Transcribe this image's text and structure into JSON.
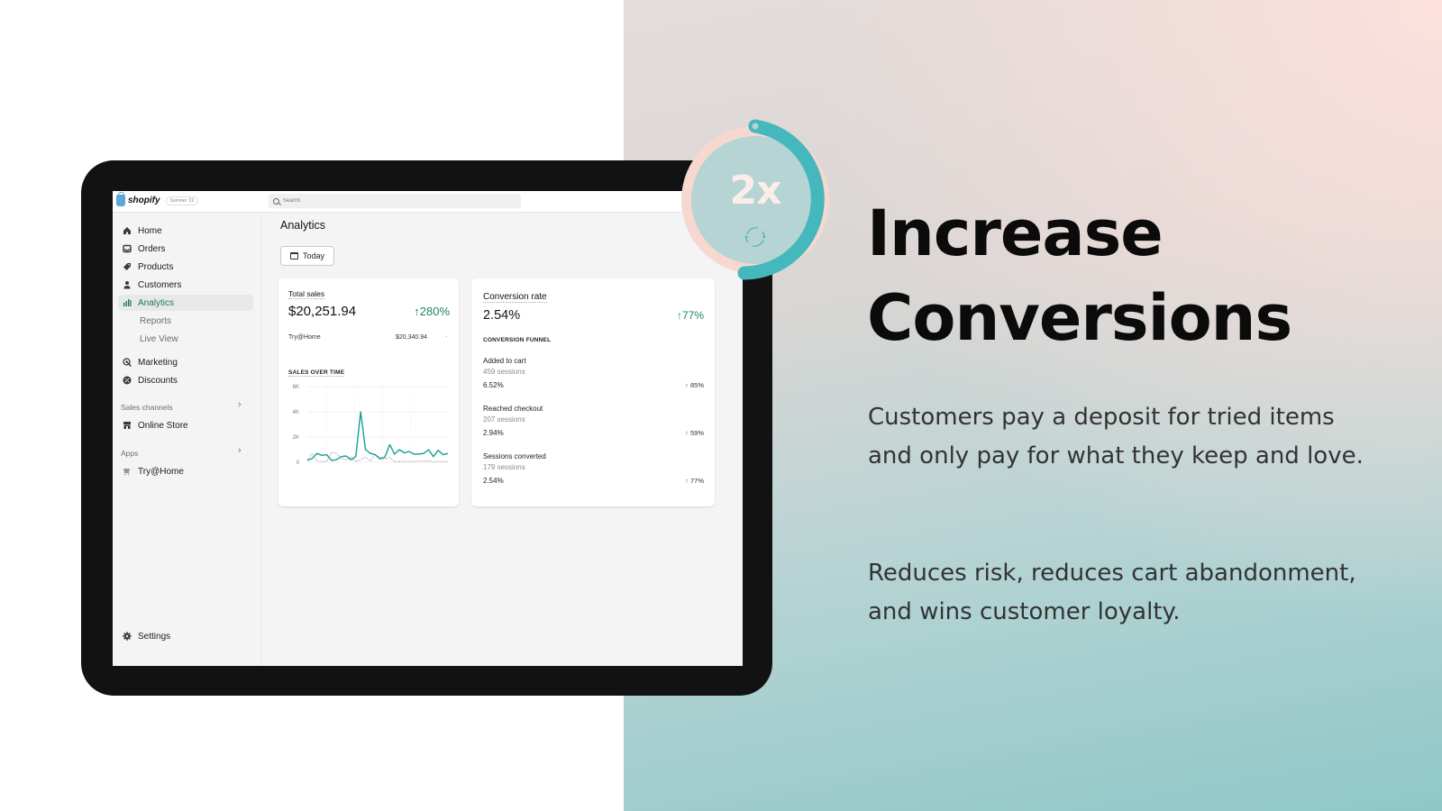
{
  "app": {
    "brand": "shopify",
    "edition_badge": "Summer '22",
    "search": {
      "placeholder": "Search",
      "value": ""
    }
  },
  "sidebar": {
    "items": [
      {
        "label": "Home",
        "icon": "home-icon"
      },
      {
        "label": "Orders",
        "icon": "inbox-icon"
      },
      {
        "label": "Products",
        "icon": "tag-icon"
      },
      {
        "label": "Customers",
        "icon": "person-icon"
      },
      {
        "label": "Analytics",
        "icon": "bar-chart-icon",
        "active": true
      },
      {
        "label": "Reports",
        "sub": true
      },
      {
        "label": "Live View",
        "sub": true
      },
      {
        "label": "Marketing",
        "icon": "target-icon"
      },
      {
        "label": "Discounts",
        "icon": "percent-badge-icon"
      }
    ],
    "sales_channels": {
      "label": "Sales channels",
      "items": [
        {
          "label": "Online Store",
          "icon": "store-icon"
        }
      ]
    },
    "apps": {
      "label": "Apps",
      "items": [
        {
          "label": "Try@Home",
          "icon": "app-icon"
        }
      ]
    },
    "settings": {
      "label": "Settings",
      "icon": "gear-icon"
    }
  },
  "main": {
    "title": "Analytics",
    "date_button": "Today",
    "total_sales": {
      "label": "Total sales",
      "value": "$20,251.94",
      "delta": "280%",
      "breakdown": [
        {
          "name": "Try@Home",
          "value": "$20,340.94",
          "delta": "-"
        }
      ],
      "chart_title": "SALES OVER TIME"
    },
    "conversion": {
      "label": "Conversion rate",
      "value": "2.54%",
      "delta": "77%",
      "funnel_title": "CONVERSION FUNNEL",
      "steps": [
        {
          "name": "Added to cart",
          "sessions": "459 sessions",
          "rate": "6.52%",
          "delta": "85%"
        },
        {
          "name": "Reached checkout",
          "sessions": "207 sessions",
          "rate": "2.94%",
          "delta": "59%"
        },
        {
          "name": "Sessions converted",
          "sessions": "179 sessions",
          "rate": "2.54%",
          "delta": "77%"
        }
      ]
    }
  },
  "chart_data": {
    "type": "line",
    "title": "SALES OVER TIME",
    "xlabel": "",
    "ylabel": "",
    "yticks": [
      "0",
      "2K",
      "4K",
      "6K"
    ],
    "ylim": [
      0,
      6000
    ],
    "grid": true,
    "series": [
      {
        "name": "current",
        "style": "solid",
        "color": "#1a9e96",
        "values": [
          150,
          300,
          700,
          550,
          600,
          150,
          200,
          450,
          500,
          200,
          450,
          4000,
          1000,
          700,
          600,
          300,
          400,
          1400,
          650,
          1000,
          750,
          850,
          650,
          650,
          700,
          1000,
          450,
          950,
          600,
          700
        ]
      },
      {
        "name": "previous",
        "style": "dotted",
        "color": "#888888",
        "values": [
          200,
          700,
          100,
          50,
          50,
          800,
          700,
          300,
          200,
          400,
          50,
          200,
          400,
          100,
          600,
          200,
          250,
          400,
          50,
          50,
          50,
          50,
          50,
          80,
          100,
          100,
          50,
          50,
          50,
          50
        ]
      }
    ]
  },
  "promo": {
    "badge": "2x",
    "badge_progress": 0.5,
    "headline_line1": "Increase",
    "headline_line2": "Conversions",
    "paragraph1": "Customers pay a deposit for tried items and only pay for what they keep and love.",
    "paragraph2": "Reduces risk, reduces cart abandonment, and wins customer loyalty.",
    "colors": {
      "teal": "#45b8bd",
      "pink": "#f7d9d2",
      "inner": "#b5d4d3"
    }
  }
}
